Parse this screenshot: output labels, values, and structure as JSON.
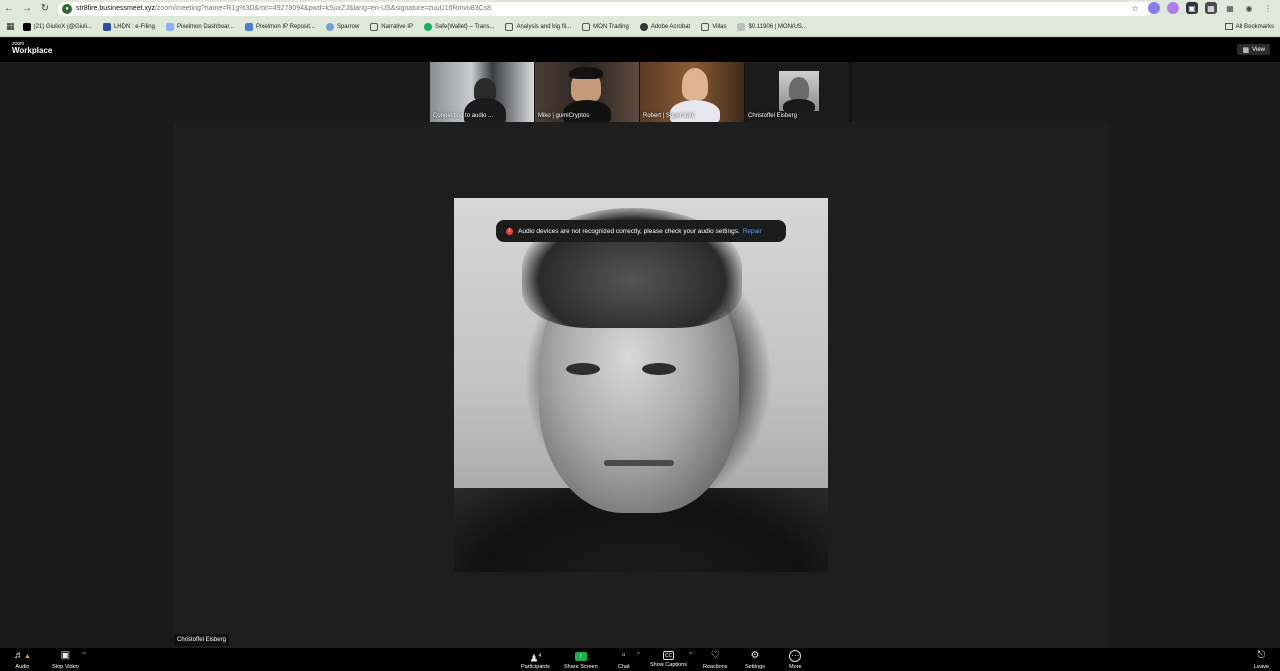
{
  "browser": {
    "url_host": "str8fire.businessmeet.xyz",
    "url_path": "/zoom/meeting?name=R1g%3D&mn=49278094&pwd=kSuxZJ&lang=en-US&signature=zuuU16Rmvu83Cs8",
    "bookmarks": [
      "(21) GiulioX (@Giuli...",
      "LHDN : e-Filing",
      "Pixelmon Dashboar...",
      "Pixelmon IP Reposit...",
      "Sparrow",
      "Narrative IP",
      "Safe{Wallet} – Trans...",
      "Analysis and big fil...",
      "MON Trading",
      "Adobe Acrobat",
      "Villas",
      "$0.11906 | MON/US..."
    ],
    "all_bookmarks": "All Bookmarks"
  },
  "zoom": {
    "logo_top": "zoom",
    "logo_bottom": "Workplace",
    "view_label": "View"
  },
  "participants": [
    {
      "name": "Connecting to audio ..."
    },
    {
      "name": "Miko | gumiCryptos"
    },
    {
      "name": "Robert | Superstate"
    },
    {
      "name": "Christoffel Eisberg"
    }
  ],
  "stage": {
    "speaker_name": "Christoffel Eisberg",
    "toast_message": "Audio devices are not recognized correctly, please check your audio settings.",
    "toast_action": "Repair"
  },
  "toolbar": {
    "audio": "Audio",
    "stop_video": "Stop Video",
    "participants": "Participants",
    "participants_count": "4",
    "share_screen": "Share Screen",
    "chat": "Chat",
    "show_captions": "Show Captions",
    "reactions": "Reactions",
    "settings": "Settings",
    "more": "More",
    "leave": "Leave"
  }
}
